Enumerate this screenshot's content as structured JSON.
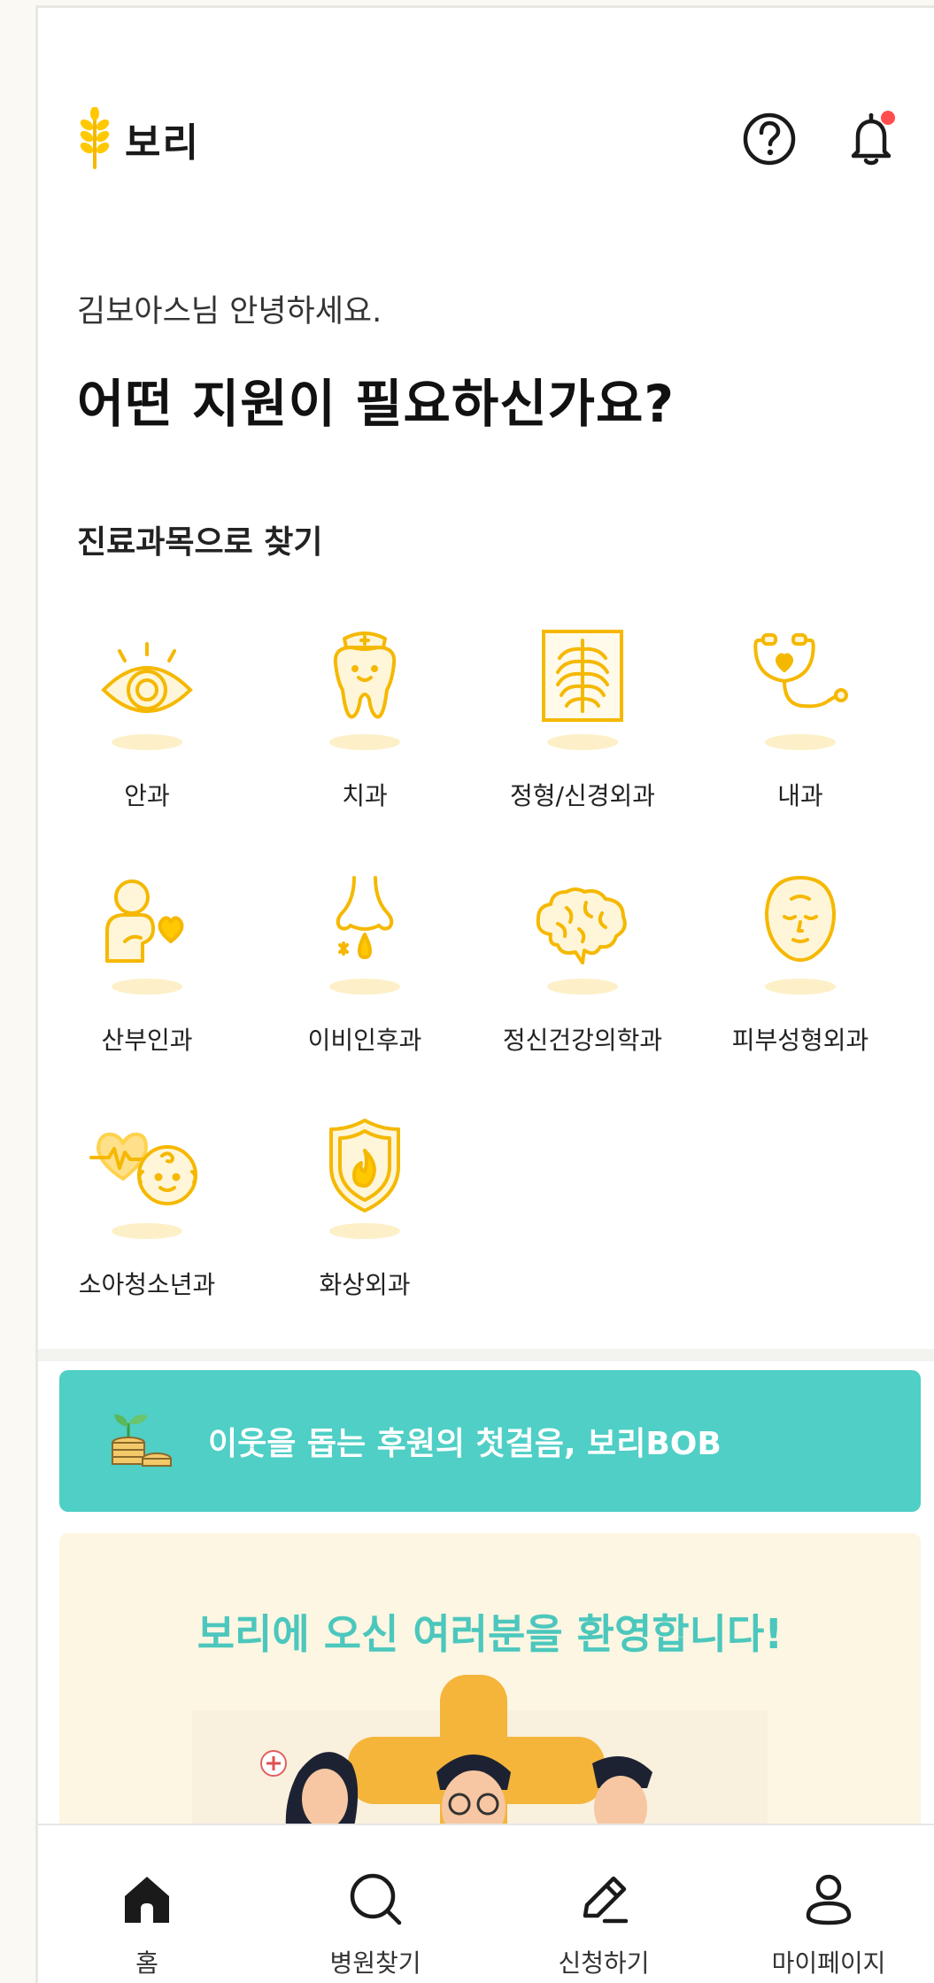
{
  "header": {
    "app_name": "보리",
    "help_icon": "question-circle-icon",
    "notification_icon": "bell-icon"
  },
  "greeting": "김보아스님 안녕하세요.",
  "headline": "어떤 지원이 필요하신가요?",
  "section_title": "진료과목으로 찾기",
  "departments": [
    {
      "label": "안과",
      "icon": "eye-icon"
    },
    {
      "label": "치과",
      "icon": "tooth-icon"
    },
    {
      "label": "정형/신경외과",
      "icon": "xray-ribs-icon"
    },
    {
      "label": "내과",
      "icon": "stethoscope-icon"
    },
    {
      "label": "산부인과",
      "icon": "mother-heart-icon"
    },
    {
      "label": "이비인후과",
      "icon": "nose-icon"
    },
    {
      "label": "정신건강의학과",
      "icon": "brain-icon"
    },
    {
      "label": "피부성형외과",
      "icon": "face-icon"
    },
    {
      "label": "소아청소년과",
      "icon": "baby-heartbeat-icon"
    },
    {
      "label": "화상외과",
      "icon": "fire-shield-icon"
    }
  ],
  "bob_banner": {
    "text": "이웃을 돕는 후원의 첫걸음,  보리BOB",
    "icon": "sprout-coins-icon"
  },
  "welcome_card": {
    "title": "보리에 오신 여러분을 환영합니다!"
  },
  "bottom_nav": [
    {
      "label": "홈",
      "icon": "home-icon"
    },
    {
      "label": "병원찾기",
      "icon": "search-icon"
    },
    {
      "label": "신청하기",
      "icon": "pencil-icon"
    },
    {
      "label": "마이페이지",
      "icon": "user-icon"
    }
  ],
  "colors": {
    "brand_yellow": "#ffc800",
    "icon_yellow": "#f5b800",
    "teal": "#4fcfc5",
    "notification_dot": "#ff4d4d",
    "welcome_bg": "#fdf6e2"
  }
}
